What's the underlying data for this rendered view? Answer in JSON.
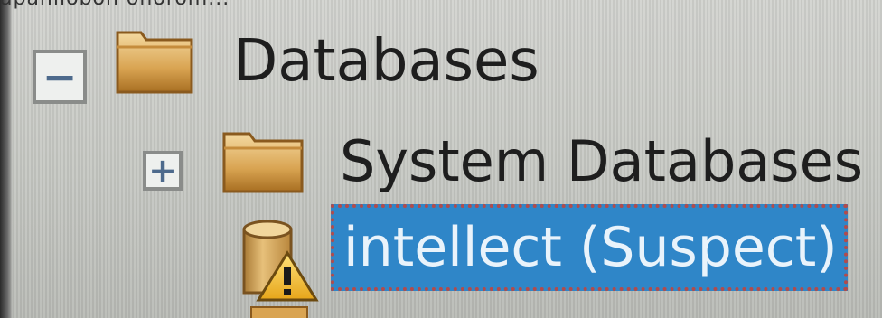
{
  "header_partial_text": "apanilobon onorom...",
  "tree": {
    "root": {
      "expander": "−",
      "label": "Databases",
      "icon": "folder-icon"
    },
    "children": [
      {
        "expander": "+",
        "label": "System Databases",
        "icon": "folder-icon"
      },
      {
        "label": "intellect (Suspect)",
        "icon": "database-warning-icon",
        "selected": true
      }
    ]
  },
  "colors": {
    "selection_bg": "#2f86c8",
    "selection_border": "#b24b4b",
    "folder": "#d4a55a",
    "text": "#1e1e1e"
  }
}
